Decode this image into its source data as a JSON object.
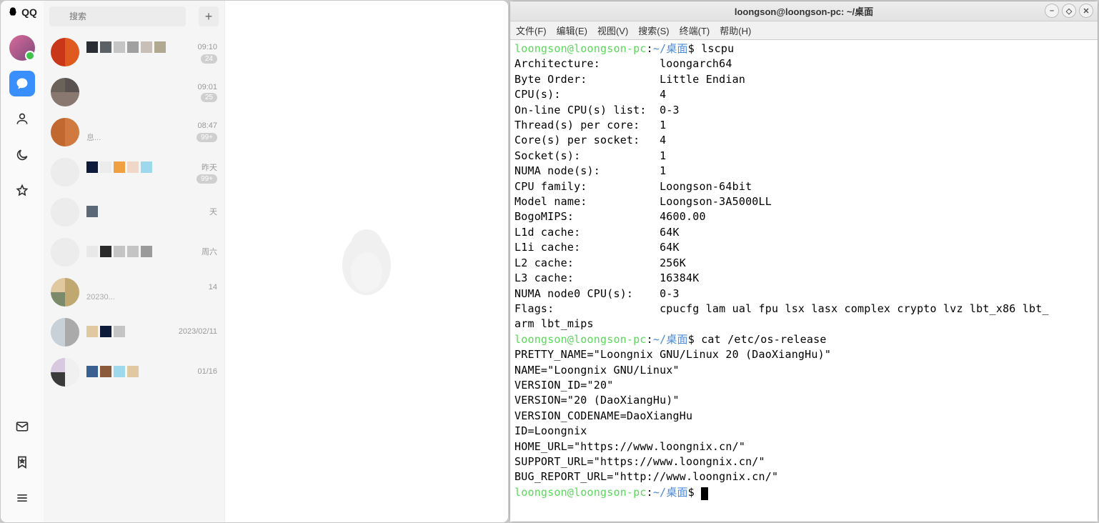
{
  "qq": {
    "app_title": "QQ",
    "search_placeholder": "搜索",
    "add_glyph": "+",
    "chats": [
      {
        "time": "09:10",
        "badge": "24",
        "preview": "",
        "blocks": [
          "#2a2e34",
          "#5c6166",
          "#c5c5c5",
          "#a0a0a0",
          "#c8c0b8",
          "#b0a890"
        ],
        "ava": [
          "#c83818",
          "#e05a20",
          "#c83818",
          "#e05a20"
        ]
      },
      {
        "time": "09:01",
        "badge": "25",
        "preview": "",
        "blocks": [],
        "ava": [
          "#6c625c",
          "#5a5250",
          "#887870",
          "#887870"
        ]
      },
      {
        "time": "08:47",
        "badge": "99+",
        "preview": "息...",
        "blocks": [],
        "ava": [
          "#c06830",
          "#d07a40",
          "#c06830",
          "#d07a40"
        ]
      },
      {
        "time": "昨天",
        "badge": "99+",
        "preview": "",
        "blocks": [
          "#0e1a3a",
          "#ececec",
          "#f0a040",
          "#f0d8c8",
          "#9ed8ec"
        ],
        "ava": [
          "#ececec",
          "#ececec",
          "#ececec",
          "#ececec"
        ]
      },
      {
        "time": "天",
        "badge": "",
        "preview": "",
        "blocks": [
          "#5a6878"
        ],
        "ava": [
          "#ececec",
          "#ececec",
          "#ececec",
          "#ececec"
        ]
      },
      {
        "time": "周六",
        "badge": "",
        "preview": "",
        "blocks": [
          "#e8e8e8",
          "#2a2a2a",
          "#c4c4c4",
          "#c4c4c4",
          "#9a9a9a"
        ],
        "ava": [
          "#ececec",
          "#ececec",
          "#ececec",
          "#ececec"
        ]
      },
      {
        "time": "14",
        "badge": "",
        "preview": "20230...",
        "blocks": [],
        "ava": [
          "#e0c8a0",
          "#c0a870",
          "#7a8a6a",
          "#c0a870"
        ]
      },
      {
        "time": "2023/02/11",
        "badge": "",
        "preview": "",
        "blocks": [
          "#e0c8a0",
          "#0e1a3a",
          "#c4c4c4"
        ],
        "ava": [
          "#c8d0d8",
          "#aaa",
          "#c8d0d8",
          "#aaa"
        ]
      },
      {
        "time": "01/16",
        "badge": "",
        "preview": "",
        "blocks": [
          "#3a6090",
          "#8a5a3a",
          "#9ed8ec",
          "#e0c8a0"
        ],
        "ava": [
          "#d8c8e0",
          "#f0f0f0",
          "#3a3a3a",
          "#f0f0f0"
        ]
      }
    ]
  },
  "terminal": {
    "title": "loongson@loongson-pc: ~/桌面",
    "menu": [
      "文件(F)",
      "编辑(E)",
      "视图(V)",
      "搜索(S)",
      "终端(T)",
      "帮助(H)"
    ],
    "prompt_user": "loongson@loongson-pc",
    "prompt_sep": ":",
    "prompt_tilde": "~",
    "prompt_path": "/桌面",
    "prompt_end": "$",
    "cmd1": "lscpu",
    "lscpu": [
      [
        "Architecture:",
        "loongarch64"
      ],
      [
        "Byte Order:",
        "Little Endian"
      ],
      [
        "CPU(s):",
        "4"
      ],
      [
        "On-line CPU(s) list:",
        "0-3"
      ],
      [
        "Thread(s) per core:",
        "1"
      ],
      [
        "Core(s) per socket:",
        "4"
      ],
      [
        "Socket(s):",
        "1"
      ],
      [
        "NUMA node(s):",
        "1"
      ],
      [
        "CPU family:",
        "Loongson-64bit"
      ],
      [
        "Model name:",
        "Loongson-3A5000LL"
      ],
      [
        "BogoMIPS:",
        "4600.00"
      ],
      [
        "L1d cache:",
        "64K"
      ],
      [
        "L1i cache:",
        "64K"
      ],
      [
        "L2 cache:",
        "256K"
      ],
      [
        "L3 cache:",
        "16384K"
      ],
      [
        "NUMA node0 CPU(s):",
        "0-3"
      ],
      [
        "Flags:",
        "cpucfg lam ual fpu lsx lasx complex crypto lvz lbt_x86 lbt_"
      ]
    ],
    "flags_wrap": "arm lbt_mips",
    "cmd2": "cat /etc/os-release",
    "osrelease": [
      "PRETTY_NAME=\"Loongnix GNU/Linux 20 (DaoXiangHu)\"",
      "NAME=\"Loongnix GNU/Linux\"",
      "VERSION_ID=\"20\"",
      "VERSION=\"20 (DaoXiangHu)\"",
      "VERSION_CODENAME=DaoXiangHu",
      "ID=Loongnix",
      "HOME_URL=\"https://www.loongnix.cn/\"",
      "SUPPORT_URL=\"https://www.loongnix.cn/\"",
      "BUG_REPORT_URL=\"http://www.loongnix.cn/\""
    ]
  }
}
